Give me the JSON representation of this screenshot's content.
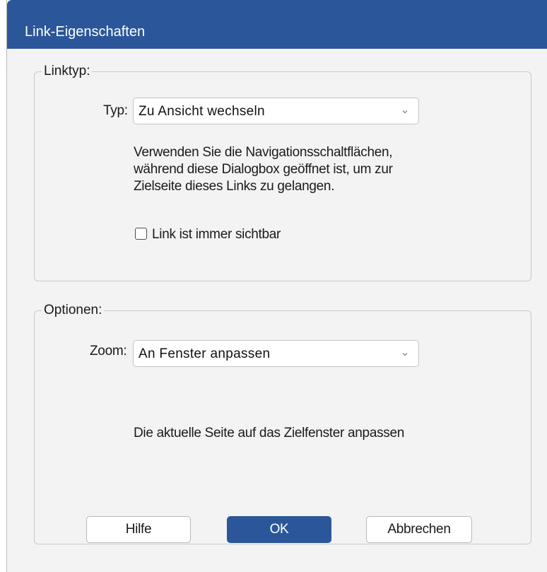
{
  "dialog": {
    "title": "Link-Eigenschaften"
  },
  "linktype_group": {
    "legend": "Linktyp:",
    "type_label": "Typ:",
    "type_value": "Zu Ansicht wechseln",
    "description_lines": [
      "Verwenden Sie die Navigationsschaltflächen,",
      "während diese Dialogbox geöffnet ist, um zur",
      "Zielseite dieses Links zu gelangen."
    ],
    "always_visible_label": "Link ist immer sichtbar",
    "always_visible_checked": false
  },
  "options_group": {
    "legend": "Optionen:",
    "zoom_label": "Zoom:",
    "zoom_value": "An Fenster anpassen",
    "description": "Die aktuelle Seite auf das Zielfenster anpassen"
  },
  "buttons": {
    "help": "Hilfe",
    "ok": "OK",
    "cancel": "Abbrechen"
  },
  "colors": {
    "accent": "#2b579a",
    "dialog_background": "#f3f3f3"
  },
  "icons": {
    "dropdown": "chevron-down-icon",
    "checkbox": "checkbox-unchecked-icon"
  }
}
